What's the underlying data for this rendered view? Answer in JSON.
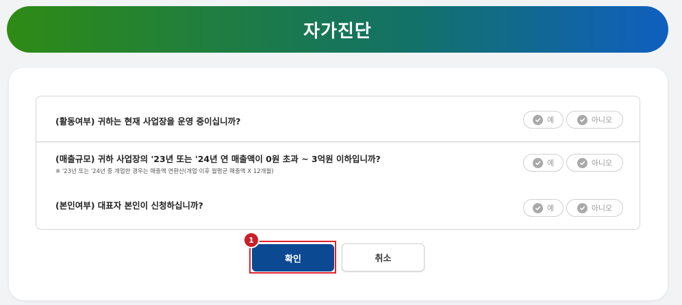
{
  "header": {
    "title": "자가진단"
  },
  "questions": [
    {
      "text": "(활동여부) 귀하는 현재 사업장을 운영 중이십니까?",
      "note": "",
      "yes_label": "예",
      "no_label": "아니오"
    },
    {
      "text": "(매출규모) 귀하 사업장의 '23년 또는 '24년 연 매출액이 0원 초과 ~ 3억원 이하입니까?",
      "note": "※ '23년 또는 '24년 중 개업한 경우는 매출액 연환산(개업 이후 월평균 매출액 X 12개월)",
      "yes_label": "예",
      "no_label": "아니오"
    },
    {
      "text": "(본인여부) 대표자 본인이 신청하십니까?",
      "note": "",
      "yes_label": "예",
      "no_label": "아니오"
    }
  ],
  "actions": {
    "confirm_label": "확인",
    "cancel_label": "취소",
    "step_number": "1"
  },
  "colors": {
    "confirm_bg": "#0b4a93",
    "highlight": "#e0202a",
    "header_start": "#2e8b14",
    "header_end": "#0f5fc0"
  }
}
